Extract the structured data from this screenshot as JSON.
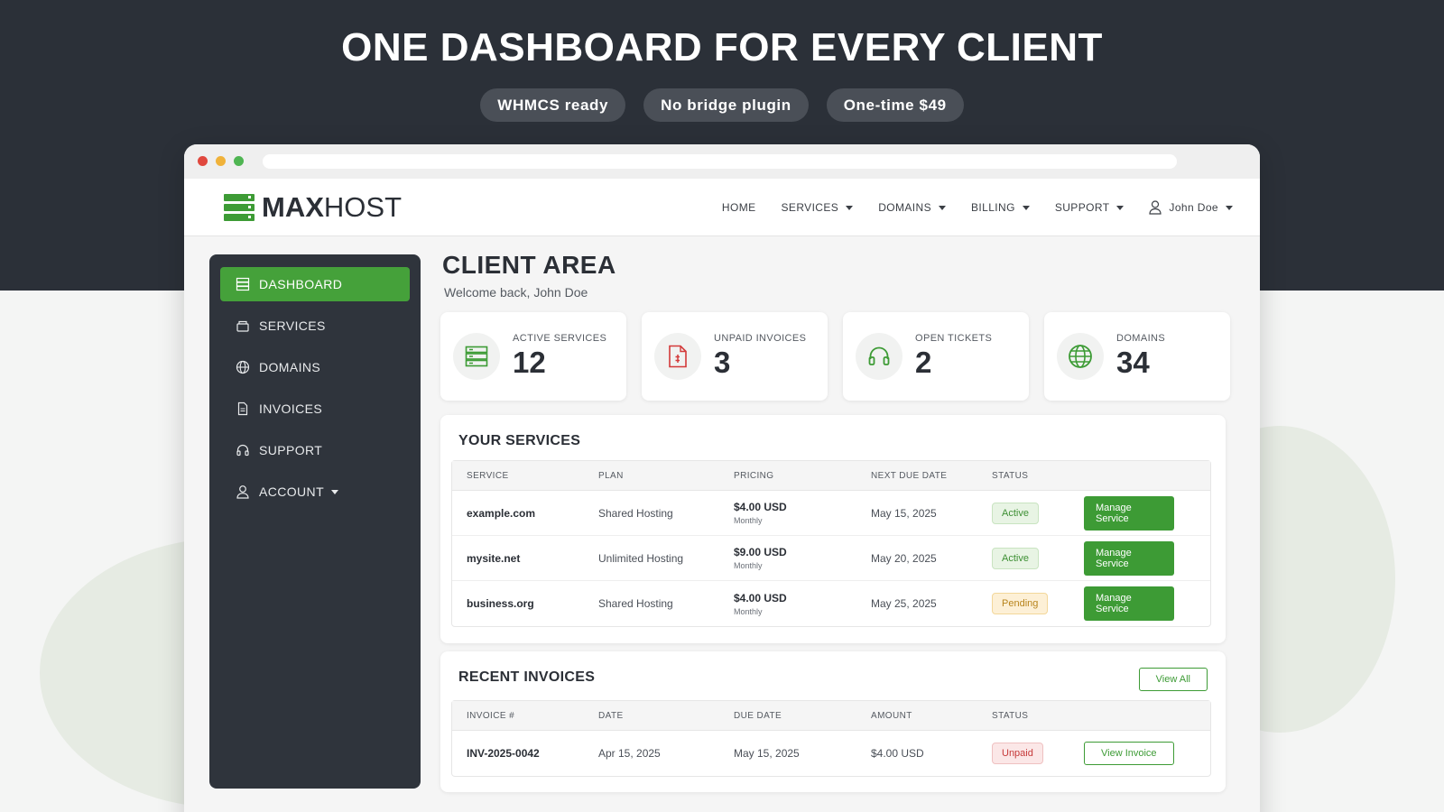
{
  "hero": {
    "title": "ONE DASHBOARD FOR EVERY CLIENT",
    "pills": [
      "WHMCS ready",
      "No bridge plugin",
      "One-time $49"
    ]
  },
  "brand": {
    "bold": "MAX",
    "light": "HOST",
    "accent": "#3d9b35"
  },
  "nav": {
    "items": [
      {
        "label": "HOME",
        "dropdown": false
      },
      {
        "label": "SERVICES",
        "dropdown": true
      },
      {
        "label": "DOMAINS",
        "dropdown": true
      },
      {
        "label": "BILLING",
        "dropdown": true
      },
      {
        "label": "SUPPORT",
        "dropdown": true
      }
    ],
    "user": "John Doe"
  },
  "sidebar": {
    "items": [
      {
        "label": "DASHBOARD",
        "icon": "server-icon",
        "active": true
      },
      {
        "label": "SERVICES",
        "icon": "box-icon",
        "active": false
      },
      {
        "label": "DOMAINS",
        "icon": "globe-icon",
        "active": false
      },
      {
        "label": "INVOICES",
        "icon": "document-icon",
        "active": false
      },
      {
        "label": "SUPPORT",
        "icon": "headset-icon",
        "active": false
      },
      {
        "label": "ACCOUNT",
        "icon": "user-icon",
        "active": false
      }
    ]
  },
  "page": {
    "title": "CLIENT AREA",
    "welcome": "Welcome back, John Doe"
  },
  "stats": [
    {
      "label": "ACTIVE SERVICES",
      "value": "12",
      "icon": "server-icon",
      "color": "#3d9b35"
    },
    {
      "label": "UNPAID INVOICES",
      "value": "3",
      "icon": "invoice-icon",
      "color": "#d33a3a"
    },
    {
      "label": "OPEN TICKETS",
      "value": "2",
      "icon": "headset-icon",
      "color": "#3d9b35"
    },
    {
      "label": "DOMAINS",
      "value": "34",
      "icon": "globe-icon",
      "color": "#3d9b35"
    }
  ],
  "services": {
    "title": "YOUR SERVICES",
    "headers": [
      "SERVICE",
      "PLAN",
      "PRICING",
      "NEXT DUE DATE",
      "STATUS"
    ],
    "rows": [
      {
        "service": "example.com",
        "plan": "Shared Hosting",
        "price": "$4.00 USD",
        "cycle": "Monthly",
        "due": "May 15, 2025",
        "status": "Active",
        "action": "Manage Service"
      },
      {
        "service": "mysite.net",
        "plan": "Unlimited Hosting",
        "price": "$9.00 USD",
        "cycle": "Monthly",
        "due": "May 20, 2025",
        "status": "Active",
        "action": "Manage Service"
      },
      {
        "service": "business.org",
        "plan": "Shared Hosting",
        "price": "$4.00 USD",
        "cycle": "Monthly",
        "due": "May 25, 2025",
        "status": "Pending",
        "action": "Manage Service"
      }
    ]
  },
  "invoices": {
    "title": "RECENT INVOICES",
    "view_all": "View All",
    "headers": [
      "INVOICE #",
      "DATE",
      "DUE DATE",
      "AMOUNT",
      "STATUS"
    ],
    "rows": [
      {
        "number": "INV-2025-0042",
        "date": "Apr 15, 2025",
        "due": "May 15, 2025",
        "amount": "$4.00 USD",
        "status": "Unpaid",
        "action": "View Invoice"
      }
    ]
  }
}
